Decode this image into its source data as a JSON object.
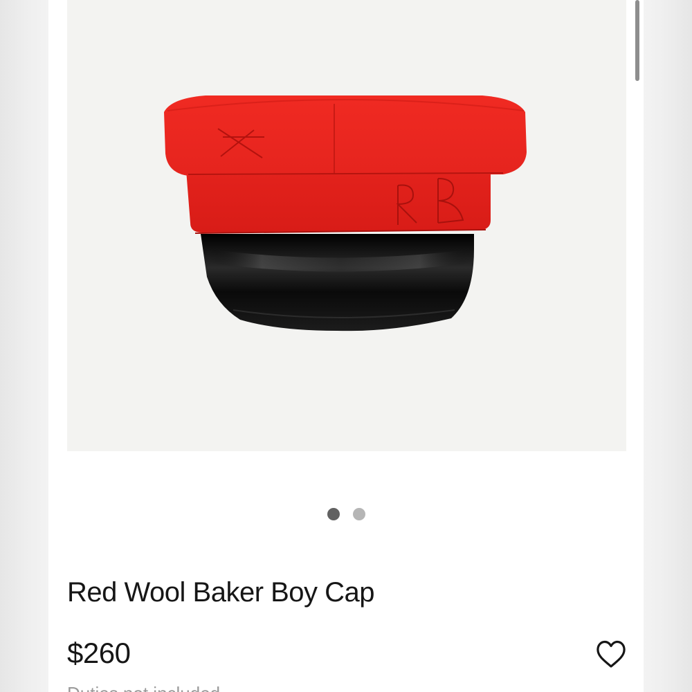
{
  "product": {
    "title": "Red Wool Baker Boy Cap",
    "price": "$260",
    "duties_note": "Duties not included",
    "image_alt": "Red Wool Baker Boy Cap",
    "embroidered_monogram": "RB"
  },
  "carousel": {
    "total_images": 2,
    "active_index": 0
  },
  "icons": {
    "wishlist": "heart-outline-icon"
  },
  "colors": {
    "cap_red": "#e8231d",
    "visor_black": "#0d0d0d",
    "image_background": "#f3f3f1",
    "dot_active": "#616161",
    "dot_inactive": "#b5b5b5",
    "text": "#161616",
    "muted_text": "#9a9a9a"
  }
}
